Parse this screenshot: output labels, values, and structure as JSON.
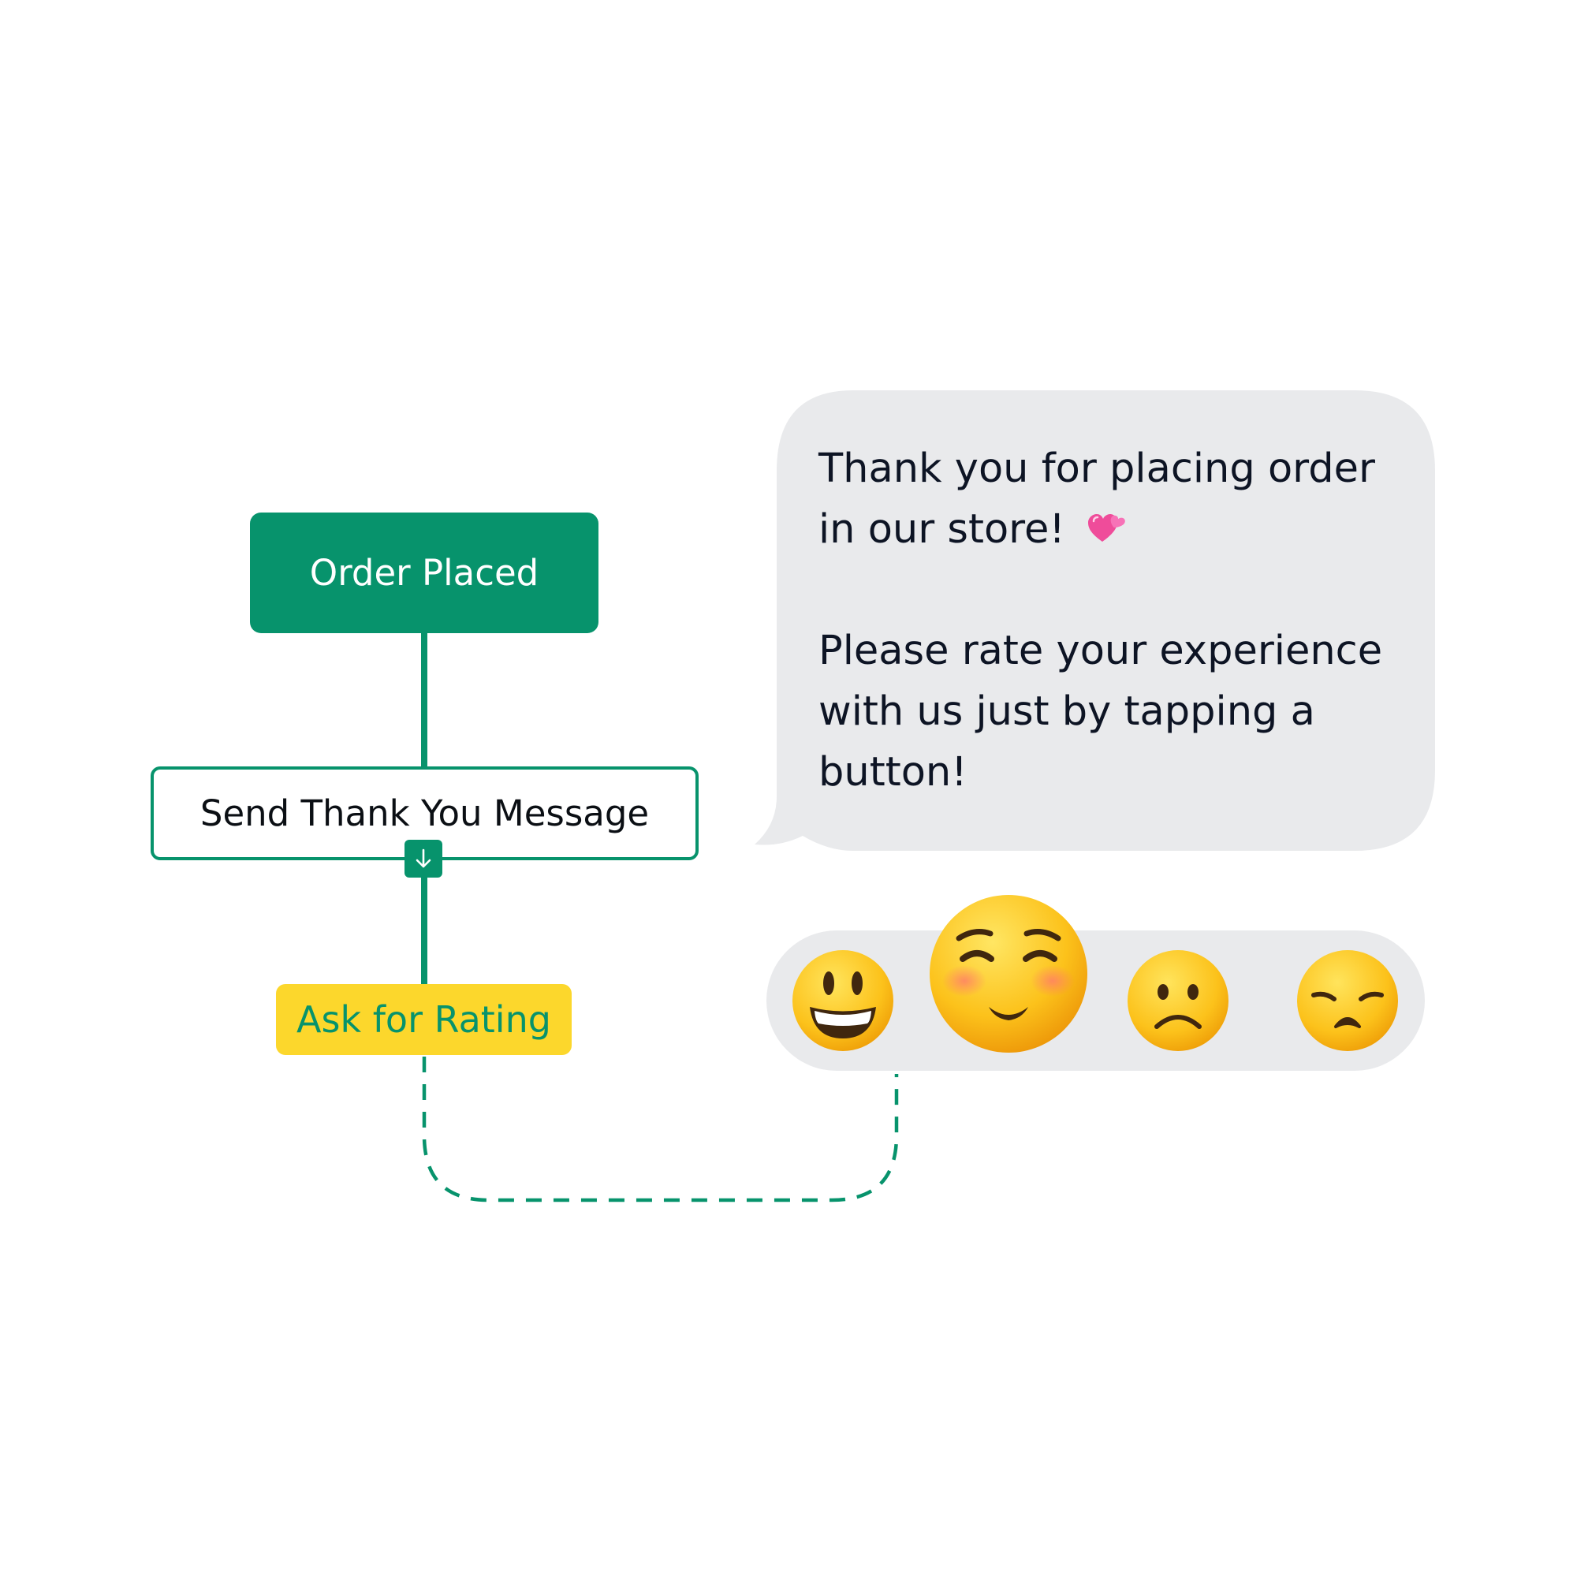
{
  "flow": {
    "nodes": {
      "order_placed": "Order Placed",
      "send_thank_you": "Send Thank You Message",
      "ask_rating": "Ask for Rating"
    }
  },
  "message": {
    "line1": "Thank you for placing order",
    "line2": "in our store!",
    "line3": "Please rate your experience",
    "line4": "with us just by tapping a",
    "line5": "button!"
  },
  "rating_options": [
    {
      "name": "grinning-face",
      "selected": false
    },
    {
      "name": "smiling-face",
      "selected": true
    },
    {
      "name": "frowning-face",
      "selected": false
    },
    {
      "name": "disappointed-face",
      "selected": false
    }
  ],
  "colors": {
    "accent": "#07936c",
    "highlight": "#fcd72c",
    "bubble": "#e9eaec",
    "text": "#0d1424"
  },
  "icons": {
    "port": "arrow-down-icon",
    "emoji_hearts": "two-hearts-icon"
  }
}
